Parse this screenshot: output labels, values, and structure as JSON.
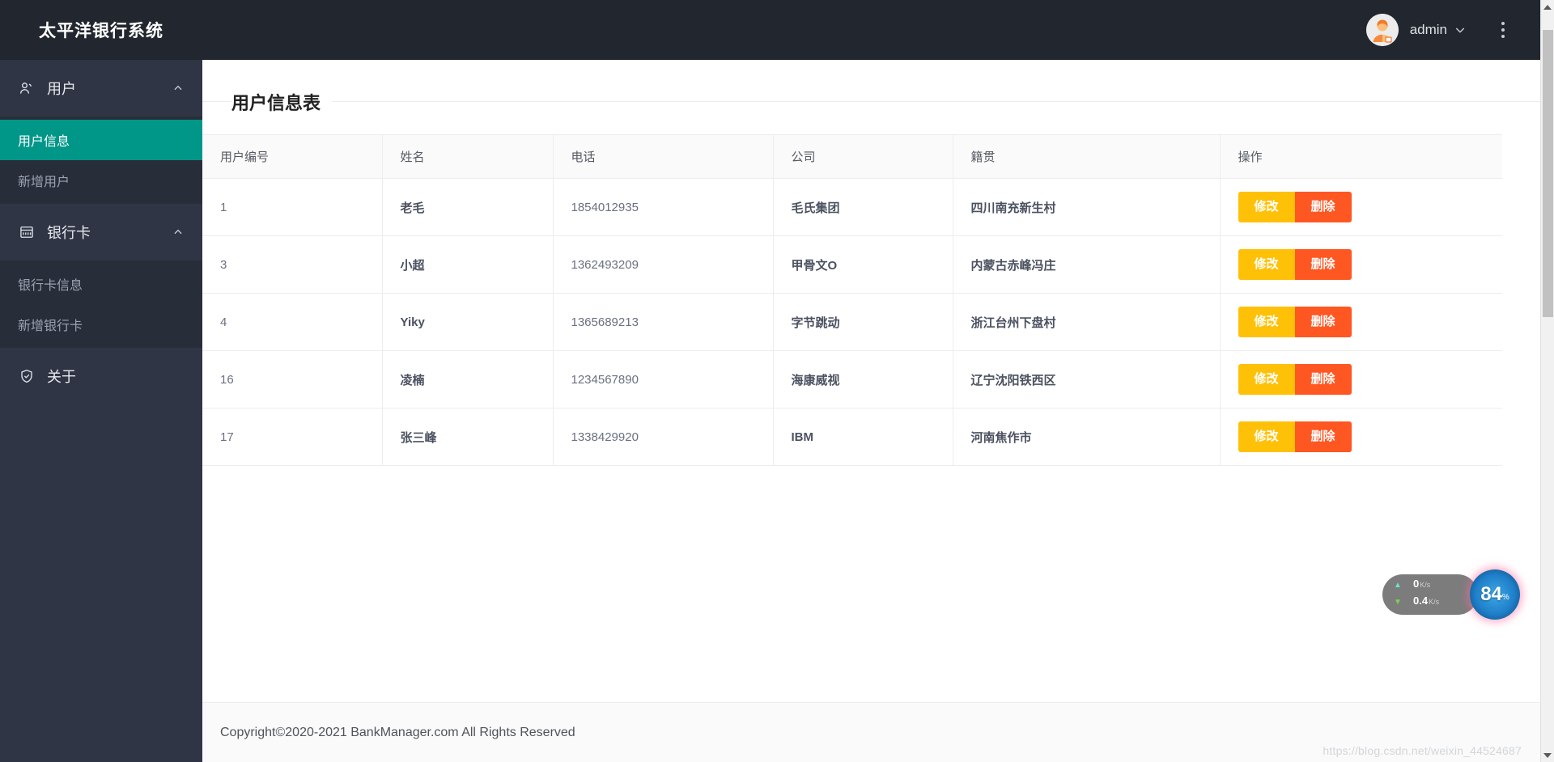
{
  "sidebar": {
    "brand": "太平洋银行系统",
    "groups": [
      {
        "label": "用户",
        "icon": "user-icon",
        "chevron": "chevron-up-icon",
        "items": [
          {
            "label": "用户信息",
            "active": true
          },
          {
            "label": "新增用户",
            "active": false
          }
        ]
      },
      {
        "label": "银行卡",
        "icon": "credit-card-icon",
        "chevron": "chevron-up-icon",
        "items": [
          {
            "label": "银行卡信息",
            "active": false
          },
          {
            "label": "新增银行卡",
            "active": false
          }
        ]
      }
    ],
    "about": {
      "label": "关于",
      "icon": "shield-check-icon"
    }
  },
  "topbar": {
    "avatar_icon": "user-avatar-icon",
    "username": "admin",
    "chevron": "chevron-down-icon",
    "kebab_icon": "more-vertical-icon"
  },
  "main": {
    "card_title": "用户信息表",
    "table": {
      "columns": [
        "用户编号",
        "姓名",
        "电话",
        "公司",
        "籍贯",
        "操作"
      ],
      "rows": [
        {
          "id": "1",
          "name": "老毛",
          "phone": "1854012935",
          "company": "毛氏集团",
          "origin": "四川南充新生村"
        },
        {
          "id": "3",
          "name": "小超",
          "phone": "1362493209",
          "company": "甲骨文O",
          "origin": "内蒙古赤峰冯庄"
        },
        {
          "id": "4",
          "name": "Yiky",
          "phone": "1365689213",
          "company": "字节跳动",
          "origin": "浙江台州下盘村"
        },
        {
          "id": "16",
          "name": "凌楠",
          "phone": "1234567890",
          "company": "海康威视",
          "origin": "辽宁沈阳铁西区"
        },
        {
          "id": "17",
          "name": "张三峰",
          "phone": "1338429920",
          "company": "IBM",
          "origin": "河南焦作市"
        }
      ],
      "actions": {
        "edit": "修改",
        "delete": "删除"
      }
    }
  },
  "footer": {
    "copyright": "Copyright©2020-2021 BankManager.com All Rights Reserved"
  },
  "overlay": {
    "net_widget": {
      "upload_value": "0",
      "upload_unit": "K/s",
      "download_value": "0.4",
      "download_unit": "K/s",
      "percent": "84",
      "percent_symbol": "%"
    },
    "watermark": "https://blog.csdn.net/weixin_44524687"
  },
  "colors": {
    "sidebar_bg": "#2f3545",
    "sidebar_sub_bg": "#282e39",
    "topbar_bg": "#22262e",
    "accent_active": "#009688",
    "btn_edit": "#ffc107",
    "btn_delete": "#ff5722"
  }
}
